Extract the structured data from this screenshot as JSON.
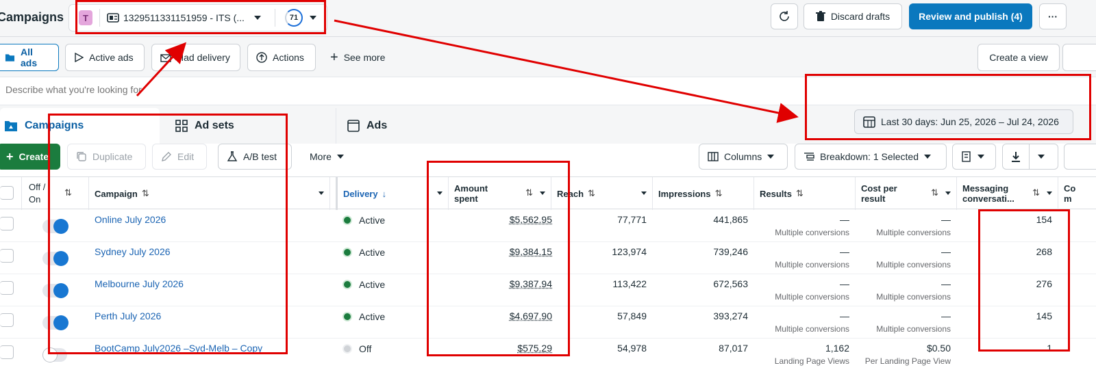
{
  "header": {
    "title": "Campaigns",
    "account_initial": "T",
    "account_id": "1329511331151959 - ITS (...",
    "badge": "71",
    "discard_label": "Discard drafts",
    "publish_label": "Review and publish (4)",
    "more_label": "···"
  },
  "filters": {
    "all_ads": "All ads",
    "active_ads": "Active ads",
    "had_delivery": "Had delivery",
    "actions": "Actions",
    "see_more": "See more",
    "create_view": "Create a view"
  },
  "search": {
    "placeholder": "Describe what you're looking for"
  },
  "tabs": {
    "campaigns": "Campaigns",
    "ad_sets": "Ad sets",
    "ads": "Ads"
  },
  "date_range": "Last 30 days: Jun 25, 2026 – Jul 24, 2026",
  "toolbar": {
    "create": "Create",
    "duplicate": "Duplicate",
    "edit": "Edit",
    "ab_test": "A/B test",
    "more": "More",
    "columns": "Columns",
    "breakdown": "Breakdown: 1 Selected"
  },
  "columns": {
    "off_on": "Off / On",
    "campaign": "Campaign",
    "delivery": "Delivery",
    "amount_spent_1": "Amount",
    "amount_spent_2": "spent",
    "reach": "Reach",
    "impressions": "Impressions",
    "results": "Results",
    "cpr_1": "Cost per",
    "cpr_2": "result",
    "msg_1": "Messaging",
    "msg_2": "conversati...",
    "next_1": "Co",
    "next_2": "m"
  },
  "rows": [
    {
      "name": "Online July 2026",
      "on": true,
      "delivery": "Active",
      "spent": "$5,562.95",
      "reach": "77,771",
      "impressions": "441,865",
      "results": "—",
      "results_sub": "Multiple conversions",
      "cpr": "—",
      "cpr_sub": "Multiple conversions",
      "messaging": "154"
    },
    {
      "name": "Sydney July 2026",
      "on": true,
      "delivery": "Active",
      "spent": "$9,384.15",
      "reach": "123,974",
      "impressions": "739,246",
      "results": "—",
      "results_sub": "Multiple conversions",
      "cpr": "—",
      "cpr_sub": "Multiple conversions",
      "messaging": "268"
    },
    {
      "name": "Melbourne July 2026",
      "on": true,
      "delivery": "Active",
      "spent": "$9,387.94",
      "reach": "113,422",
      "impressions": "672,563",
      "results": "—",
      "results_sub": "Multiple conversions",
      "cpr": "—",
      "cpr_sub": "Multiple conversions",
      "messaging": "276"
    },
    {
      "name": "Perth July 2026",
      "on": true,
      "delivery": "Active",
      "spent": "$4,697.90",
      "reach": "57,849",
      "impressions": "393,274",
      "results": "—",
      "results_sub": "Multiple conversions",
      "cpr": "—",
      "cpr_sub": "Multiple conversions",
      "messaging": "145"
    },
    {
      "name": "BootCamp July2026 –Syd-Melb – Copy",
      "on": false,
      "delivery": "Off",
      "spent": "$575.29",
      "reach": "54,978",
      "impressions": "87,017",
      "results": "1,162",
      "results_sub": "Landing Page Views",
      "cpr": "$0.50",
      "cpr_sub": "Per Landing Page View",
      "messaging": "1"
    }
  ],
  "colors": {
    "primary": "#0a78be",
    "create": "#1b7c3e",
    "annotation": "#e00000",
    "link": "#1b64b3"
  }
}
